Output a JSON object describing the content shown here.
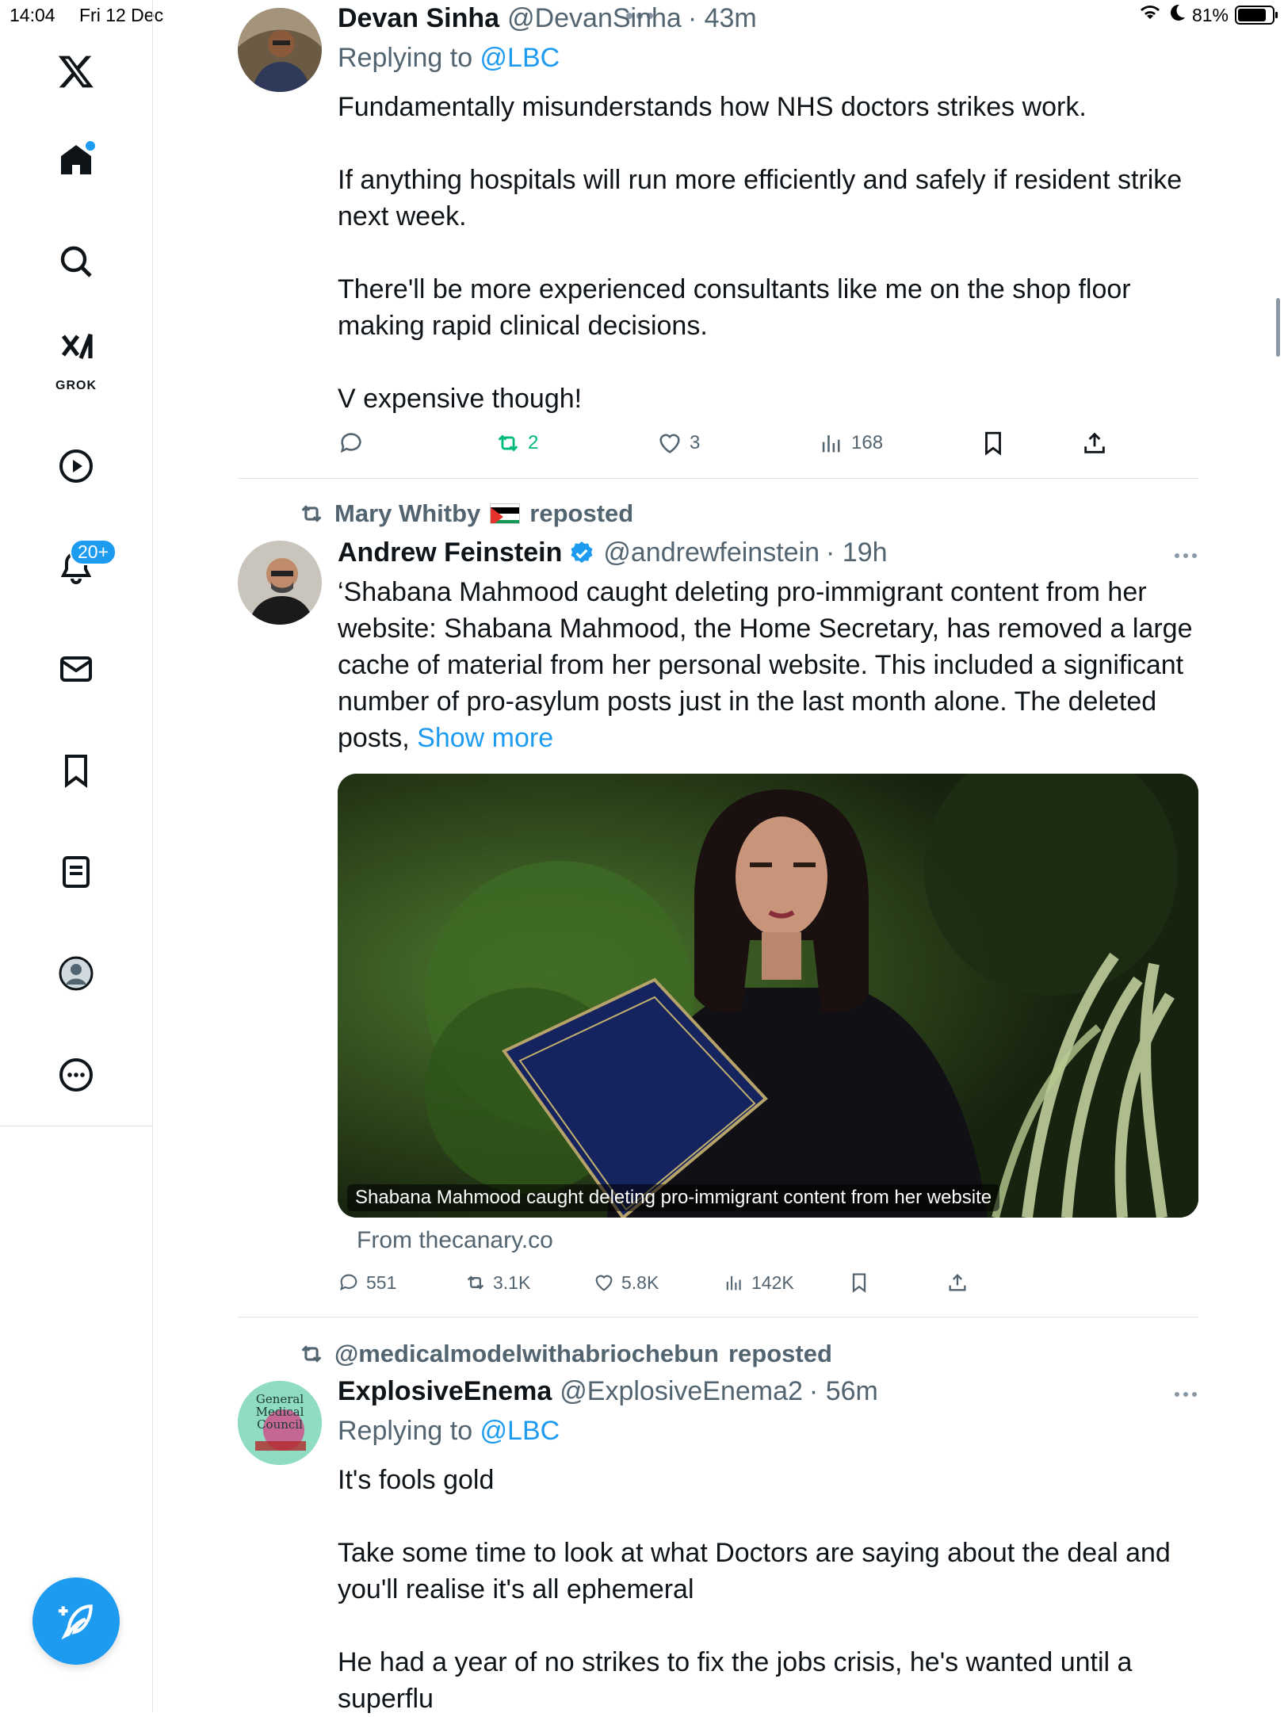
{
  "status": {
    "time": "14:04",
    "date": "Fri 12 Dec",
    "battery": "81%",
    "battery_level": 0.81
  },
  "sidebar": {
    "grok_label": "GROK",
    "notifications_badge": "20+"
  },
  "posts": [
    {
      "name": "Devan Sinha",
      "handle": "@DevanSinha",
      "time": "· 43m",
      "reply_prefix": "Replying to ",
      "reply_handle": "@LBC",
      "paragraphs": [
        "Fundamentally misunderstands how NHS doctors strikes work.",
        "If anything hospitals will run more efficiently and safely if resident strike next week.",
        "There'll be more experienced consultants like me on the shop floor making rapid clinical decisions.",
        "V expensive though!"
      ],
      "replies": "",
      "reposts": "2",
      "likes": "3",
      "views": "168"
    },
    {
      "repost_by": "Mary Whitby",
      "repost_suffix": "reposted",
      "name": "Andrew Feinstein",
      "handle": "@andrewfeinstein",
      "time": "· 19h",
      "text": "‘Shabana Mahmood caught deleting pro-immigrant content from her website:  Shabana Mahmood, the Home Secretary, has removed a large cache of material from her personal website. This included a significant number of pro-asylum posts just in the last month alone. The deleted posts, ",
      "show_more": "Show more",
      "card_caption": "Shabana Mahmood caught deleting pro-immigrant content from her website",
      "card_source": "From thecanary.co",
      "replies": "551",
      "reposts": "3.1K",
      "likes": "5.8K",
      "views": "142K"
    },
    {
      "repost_by": "@medicalmodelwithabriochebun",
      "repost_suffix": "reposted",
      "name": "ExplosiveEnema",
      "handle": "@ExplosiveEnema2",
      "time": "· 56m",
      "reply_prefix": "Replying to ",
      "reply_handle": "@LBC",
      "avatar_text": [
        "General",
        "Medical",
        "Council"
      ],
      "paragraphs": [
        "It's fools gold",
        "Take some time to look at what Doctors are saying about the deal and you'll realise it's all ephemeral",
        "He had a year of no strikes to fix the jobs crisis, he's wanted until a superflu"
      ]
    }
  ],
  "colors": {
    "accent": "#1d9bf0",
    "repost_green": "#00ba7c",
    "secondary_text": "#536471"
  }
}
